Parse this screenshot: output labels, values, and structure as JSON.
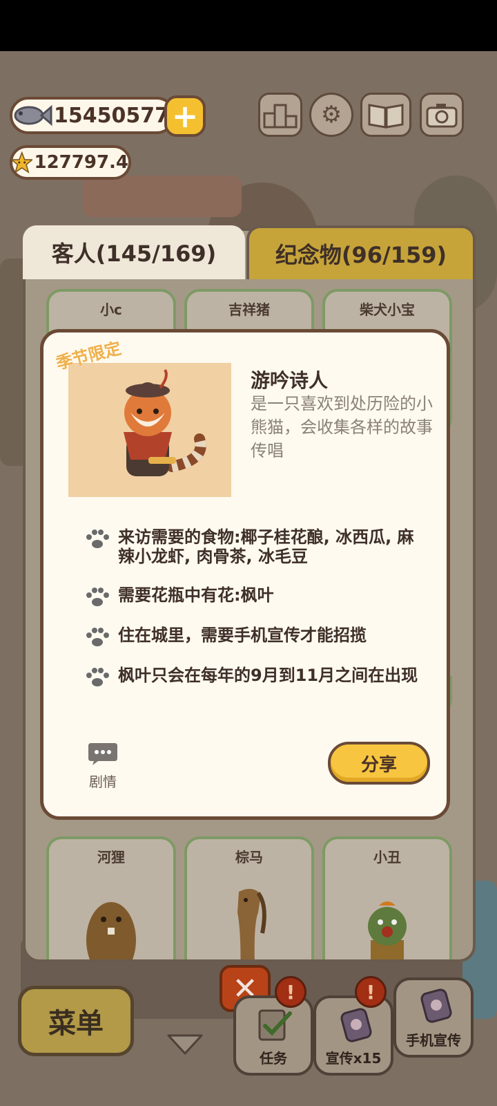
{
  "currency": {
    "fish_amount": "15450577",
    "star_amount": "127797.4"
  },
  "tabs": {
    "guests_label": "客人(145/169)",
    "souvenirs_label": "纪念物(96/159)"
  },
  "cards": [
    {
      "name": "小c"
    },
    {
      "name": "吉祥猪"
    },
    {
      "name": "柴犬小宝"
    },
    {
      "name": "河狸"
    },
    {
      "name": "棕马"
    },
    {
      "name": "小丑"
    }
  ],
  "modal": {
    "seasonal_tag": "季节限定",
    "name": "游吟诗人",
    "description": "是一只喜欢到处历险的小熊猫，会收集各样的故事传唱",
    "requirements": [
      "来访需要的食物:椰子桂花酿, 冰西瓜, 麻辣小龙虾, 肉骨茶, 冰毛豆",
      "需要花瓶中有花:枫叶",
      "住在城里，需要手机宣传才能招揽",
      "枫叶只会在每年的9月到11月之间在出现"
    ],
    "story_label": "剧情",
    "share_label": "分享"
  },
  "bottom_bar": {
    "menu_label": "菜单",
    "tasks_label": "任务",
    "promo_x15_label": "宣传x15",
    "phone_promo_label": "手机宣传",
    "badge_symbol": "!"
  },
  "colors": {
    "accent_yellow": "#f7c540",
    "panel_border": "#6a4a36",
    "card_border_green": "#7e9a65",
    "seasonal_orange": "#f0b04a",
    "close_red": "#b84318"
  }
}
